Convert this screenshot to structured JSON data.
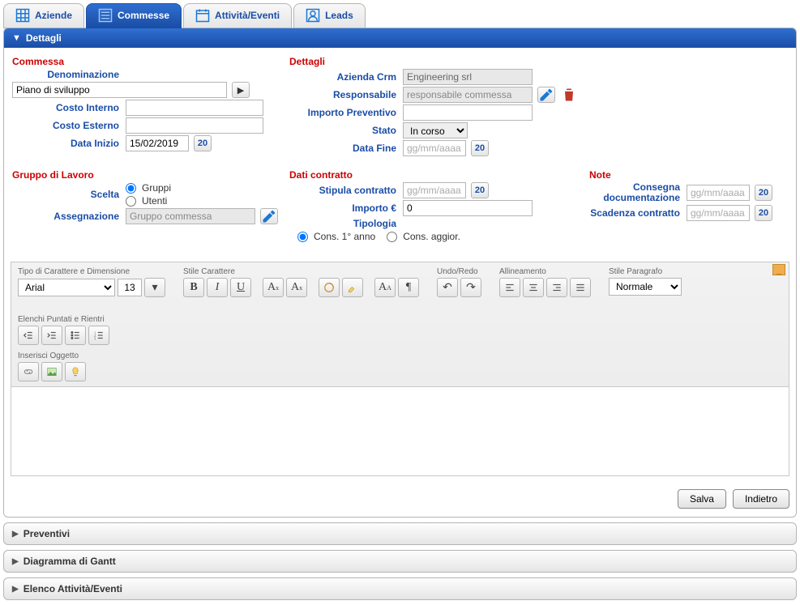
{
  "tabs": {
    "aziende": "Aziende",
    "commesse": "Commesse",
    "attivita": "Attività/Eventi",
    "leads": "Leads"
  },
  "section_header": "Dettagli",
  "c1": {
    "title": "Commessa",
    "denominazione_label": "Denominazione",
    "denominazione_value": "Piano di sviluppo",
    "costo_interno_label": "Costo Interno",
    "costo_interno_value": "",
    "costo_esterno_label": "Costo Esterno",
    "costo_esterno_value": "",
    "data_inizio_label": "Data Inizio",
    "data_inizio_value": "15/02/2019",
    "cal_text": "20",
    "group2_title": "Gruppo di Lavoro",
    "scelta_label": "Scelta",
    "scelta_gruppi": "Gruppi",
    "scelta_utenti": "Utenti",
    "assegnazione_label": "Assegnazione",
    "assegnazione_value": "Gruppo commessa"
  },
  "c2": {
    "title": "Dettagli",
    "azienda_label": "Azienda Crm",
    "azienda_value": "Engineering srl",
    "responsabile_label": "Responsabile",
    "responsabile_value": "responsabile commessa",
    "importo_prev_label": "Importo Preventivo",
    "importo_prev_value": "",
    "stato_label": "Stato",
    "stato_value": "In corso",
    "data_fine_label": "Data Fine",
    "date_placeholder": "gg/mm/aaaa",
    "group2_title": "Dati contratto",
    "stipula_label": "Stipula contratto",
    "importo_eur_label": "Importo €",
    "importo_eur_value": "0",
    "tipologia_label": "Tipologia",
    "tip_cons1": "Cons. 1° anno",
    "tip_cons_aggior": "Cons. aggior.",
    "cal_text": "20"
  },
  "c3": {
    "title": "Note",
    "consegna_label": "Consegna documentazione",
    "scadenza_label": "Scadenza contratto",
    "date_placeholder": "gg/mm/aaaa",
    "cal_text": "20"
  },
  "rte": {
    "grp_font": "Tipo di Carattere e Dimensione",
    "font_name": "Arial",
    "font_size": "13",
    "grp_stile": "Stile Carattere",
    "grp_undo": "Undo/Redo",
    "grp_align": "Allineamento",
    "grp_para": "Stile Paragrafo",
    "para_value": "Normale",
    "grp_list": "Elenchi Puntati e Rientri",
    "grp_ins": "Inserisci Oggetto"
  },
  "buttons": {
    "save": "Salva",
    "back": "Indietro"
  },
  "acc": {
    "preventivi": "Preventivi",
    "gantt": "Diagramma di Gantt",
    "elenco": "Elenco Attività/Eventi"
  }
}
